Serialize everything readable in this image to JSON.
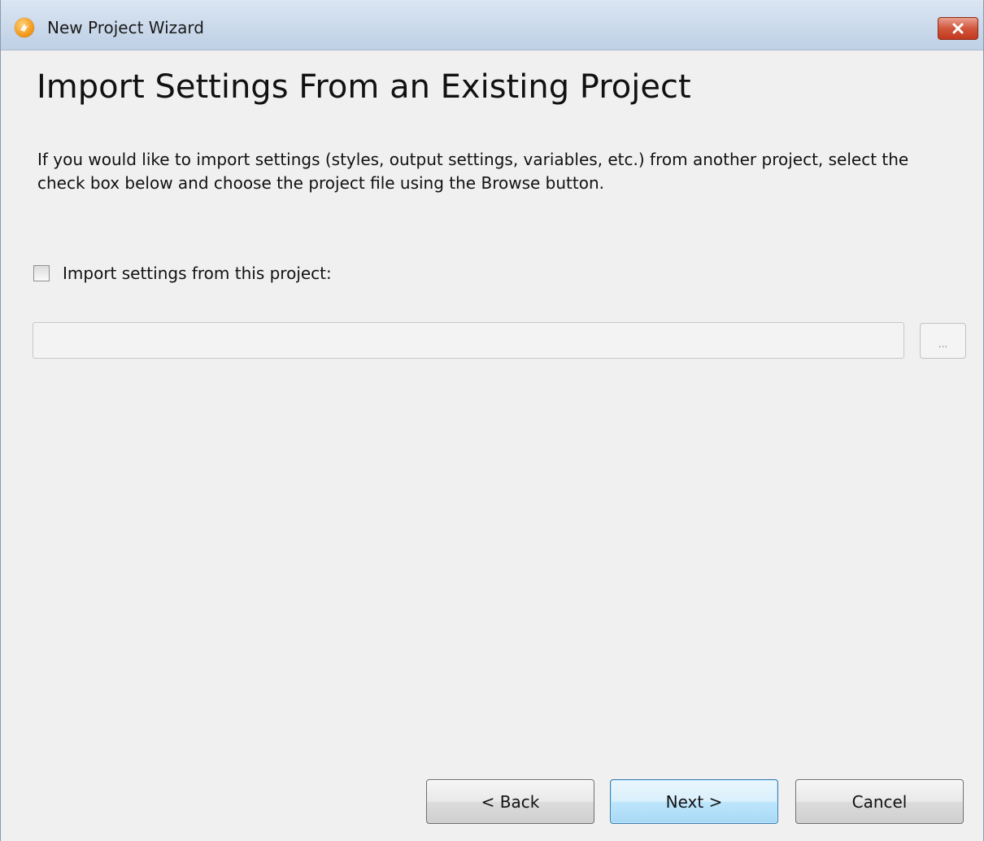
{
  "window": {
    "title": "New Project Wizard",
    "icon": "app-logo-icon",
    "close_icon": "close-icon"
  },
  "page": {
    "heading": "Import Settings From an Existing Project",
    "description": "If you would like to import settings (styles, output settings, variables, etc.) from another project, select the check box below and choose the project file using the Browse button."
  },
  "import": {
    "checkbox_label": "Import settings from this project:",
    "checked": false,
    "path_value": "",
    "browse_label": "..."
  },
  "buttons": {
    "back": "< Back",
    "next": "Next >",
    "cancel": "Cancel"
  },
  "colors": {
    "window_bg": "#f0f0f0",
    "close_button": "#c2391e",
    "default_button_border": "#3c7fb1"
  }
}
